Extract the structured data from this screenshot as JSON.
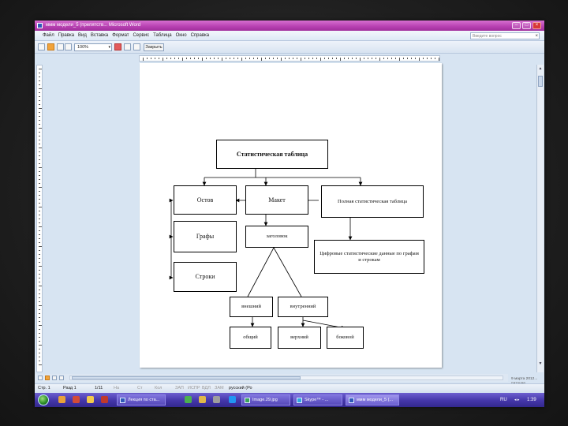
{
  "window": {
    "title": "ммм модели_5 (препятств... Microsoft Word",
    "buttons": {
      "minimize": "–",
      "maximize": "□",
      "close": "×"
    }
  },
  "menu": {
    "items": [
      "Файл",
      "Правка",
      "Вид",
      "Вставка",
      "Формат",
      "Сервис",
      "Таблица",
      "Окно",
      "Справка"
    ],
    "help_placeholder": "Введите вопрос",
    "help_close": "×"
  },
  "toolbar": {
    "zoom": "100%",
    "zoom_arrow": "▾",
    "close_label": "Закрыть"
  },
  "diagram": {
    "stat_table": "Статистическая таблица",
    "ostov": "Остов",
    "maket": "Макет",
    "grafy": "Графы",
    "stroki": "Строки",
    "full_table": "Полная статистическая таблица",
    "zagolovok": "заголовок",
    "digital_data": "Цифровые статистические данные по графам и строкам",
    "vneshniy": "внешний",
    "vnutrenniy": "внутренний",
    "obshchiy": "общий",
    "verkhniy": "верхний",
    "bokovoy": "боковой"
  },
  "status": {
    "str": "Стр. 1",
    "razd": "Разд 1",
    "pages": "1/11",
    "na": "На",
    "st": "Ст",
    "kol": "Кол",
    "modes": [
      "ЗАП",
      "ИСПР",
      "ВДЛ",
      "ЗАМ"
    ],
    "lang": "русский (Ро"
  },
  "date_area": {
    "line1": "9 марта 2012...",
    "line2": "питание"
  },
  "taskbar": {
    "tasks": [
      "Лекция по ста...",
      "Image.29.jpg",
      "Skype™ - ..."
    ],
    "active_task": "ммм модели_5 (...",
    "tray_lang": "RU",
    "clock": "1:39"
  },
  "colors": {
    "title_bar": "#b63fb0",
    "taskbar": "#4436a9",
    "workspace": "#d7e4f2"
  }
}
